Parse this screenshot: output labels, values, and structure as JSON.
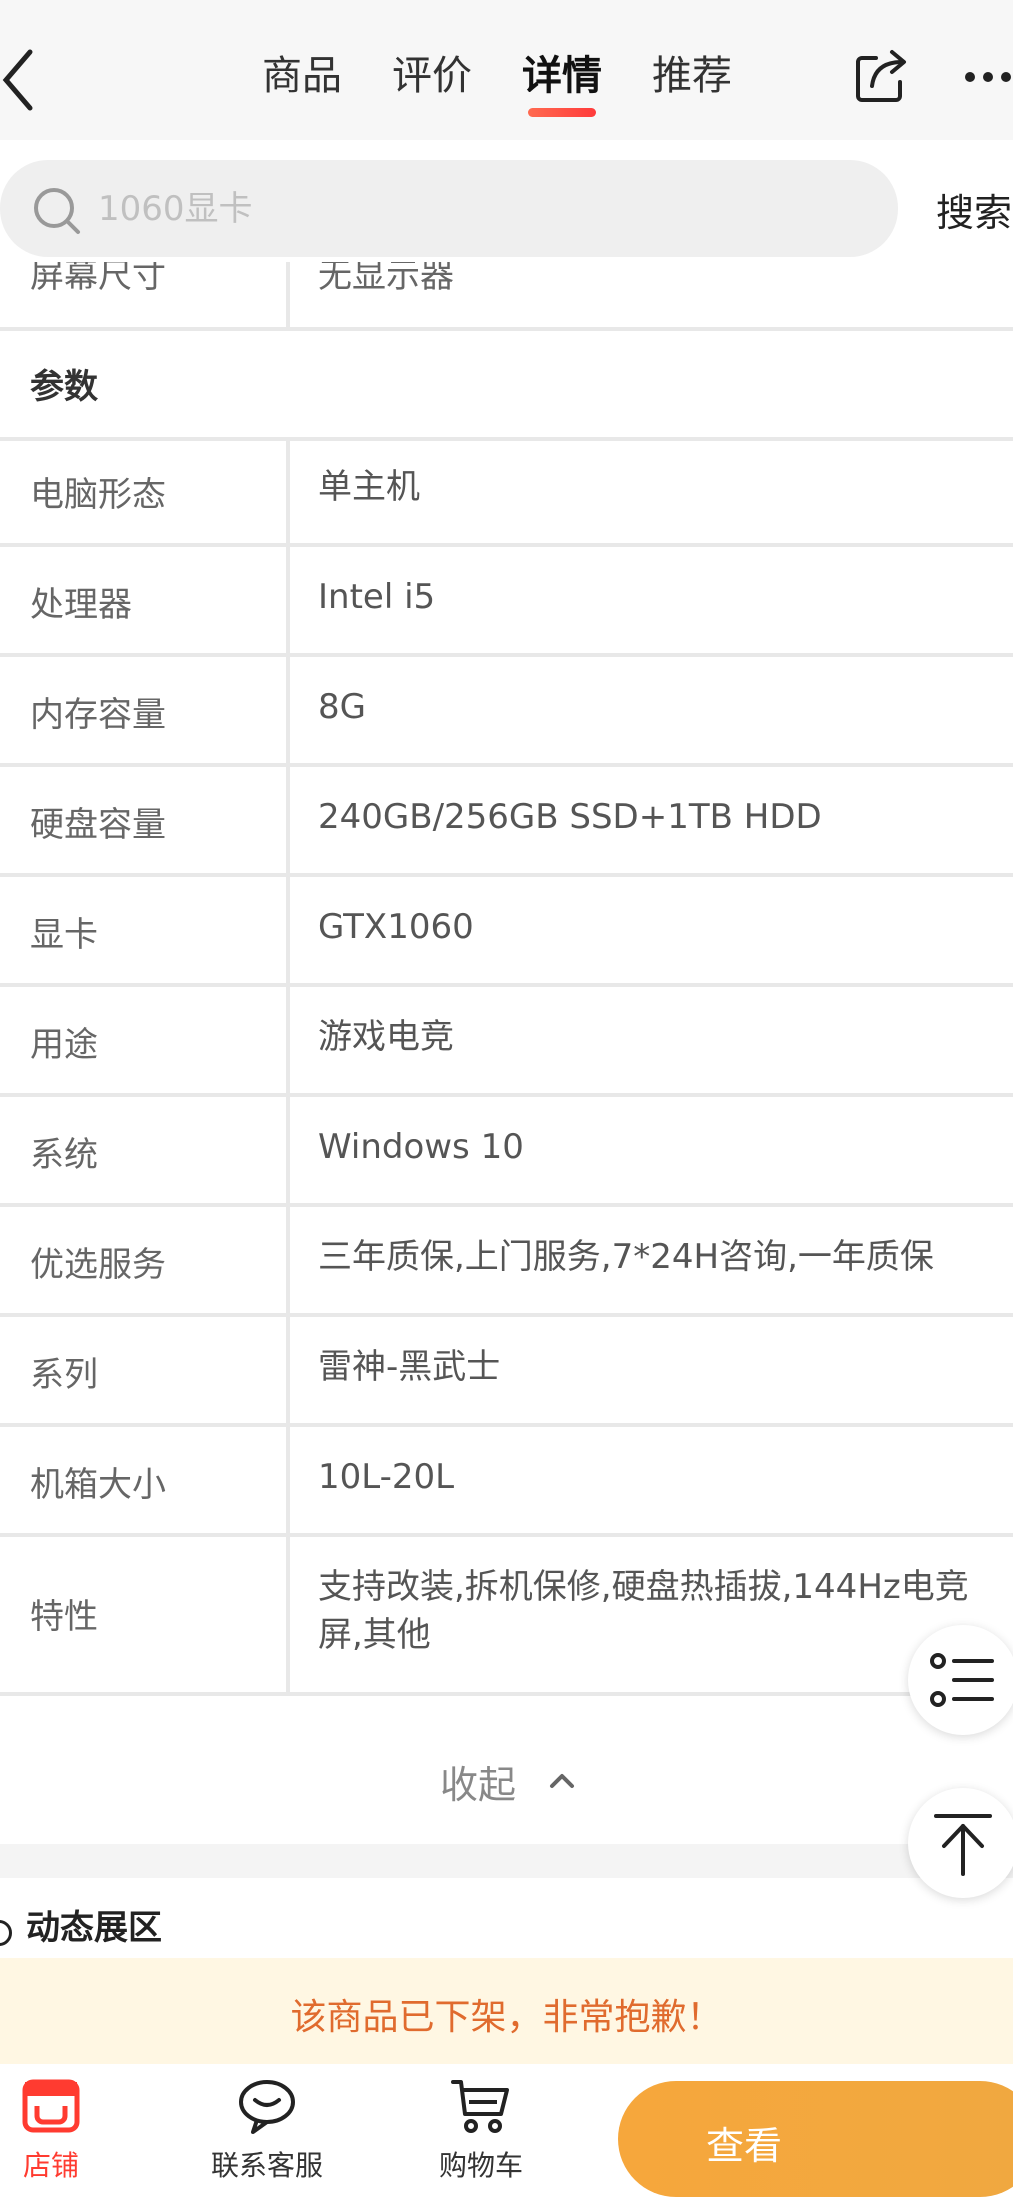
{
  "nav": {
    "tabs": [
      "商品",
      "评价",
      "详情",
      "推荐"
    ],
    "active_tab": "详情"
  },
  "search": {
    "placeholder": "1060显卡",
    "button_label": "搜索"
  },
  "spec_table": {
    "partial_row": {
      "label": "屏幕尺寸",
      "value": "无显示器"
    },
    "section_title": "参数",
    "rows": [
      {
        "label": "电脑形态",
        "value": "单主机"
      },
      {
        "label": "处理器",
        "value": "Intel i5"
      },
      {
        "label": "内存容量",
        "value": "8G"
      },
      {
        "label": "硬盘容量",
        "value": "240GB/256GB SSD+1TB HDD"
      },
      {
        "label": "显卡",
        "value": "GTX1060"
      },
      {
        "label": "用途",
        "value": "游戏电竞"
      },
      {
        "label": "系统",
        "value": "Windows 10"
      },
      {
        "label": "优选服务",
        "value": "三年质保,上门服务,7*24H咨询,一年质保"
      },
      {
        "label": "系列",
        "value": "雷神-黑武士"
      },
      {
        "label": "机箱大小",
        "value": "10L-20L"
      },
      {
        "label": "特性",
        "value": "支持改装,拆机保修,硬盘热插拔,144Hz电竞屏,其他"
      }
    ],
    "collapse_label": "收起"
  },
  "dynamic_section": {
    "title": "动态展区"
  },
  "notice": {
    "text": "该商品已下架，非常抱歉！"
  },
  "bottom_bar": {
    "store_label": "店铺",
    "service_label": "联系客服",
    "cart_label": "购物车",
    "cta_label": "查看"
  },
  "colors": {
    "accent_red": "#ff3b30",
    "cta_orange": "#f6a73c",
    "notice_text": "#e06b2e"
  }
}
